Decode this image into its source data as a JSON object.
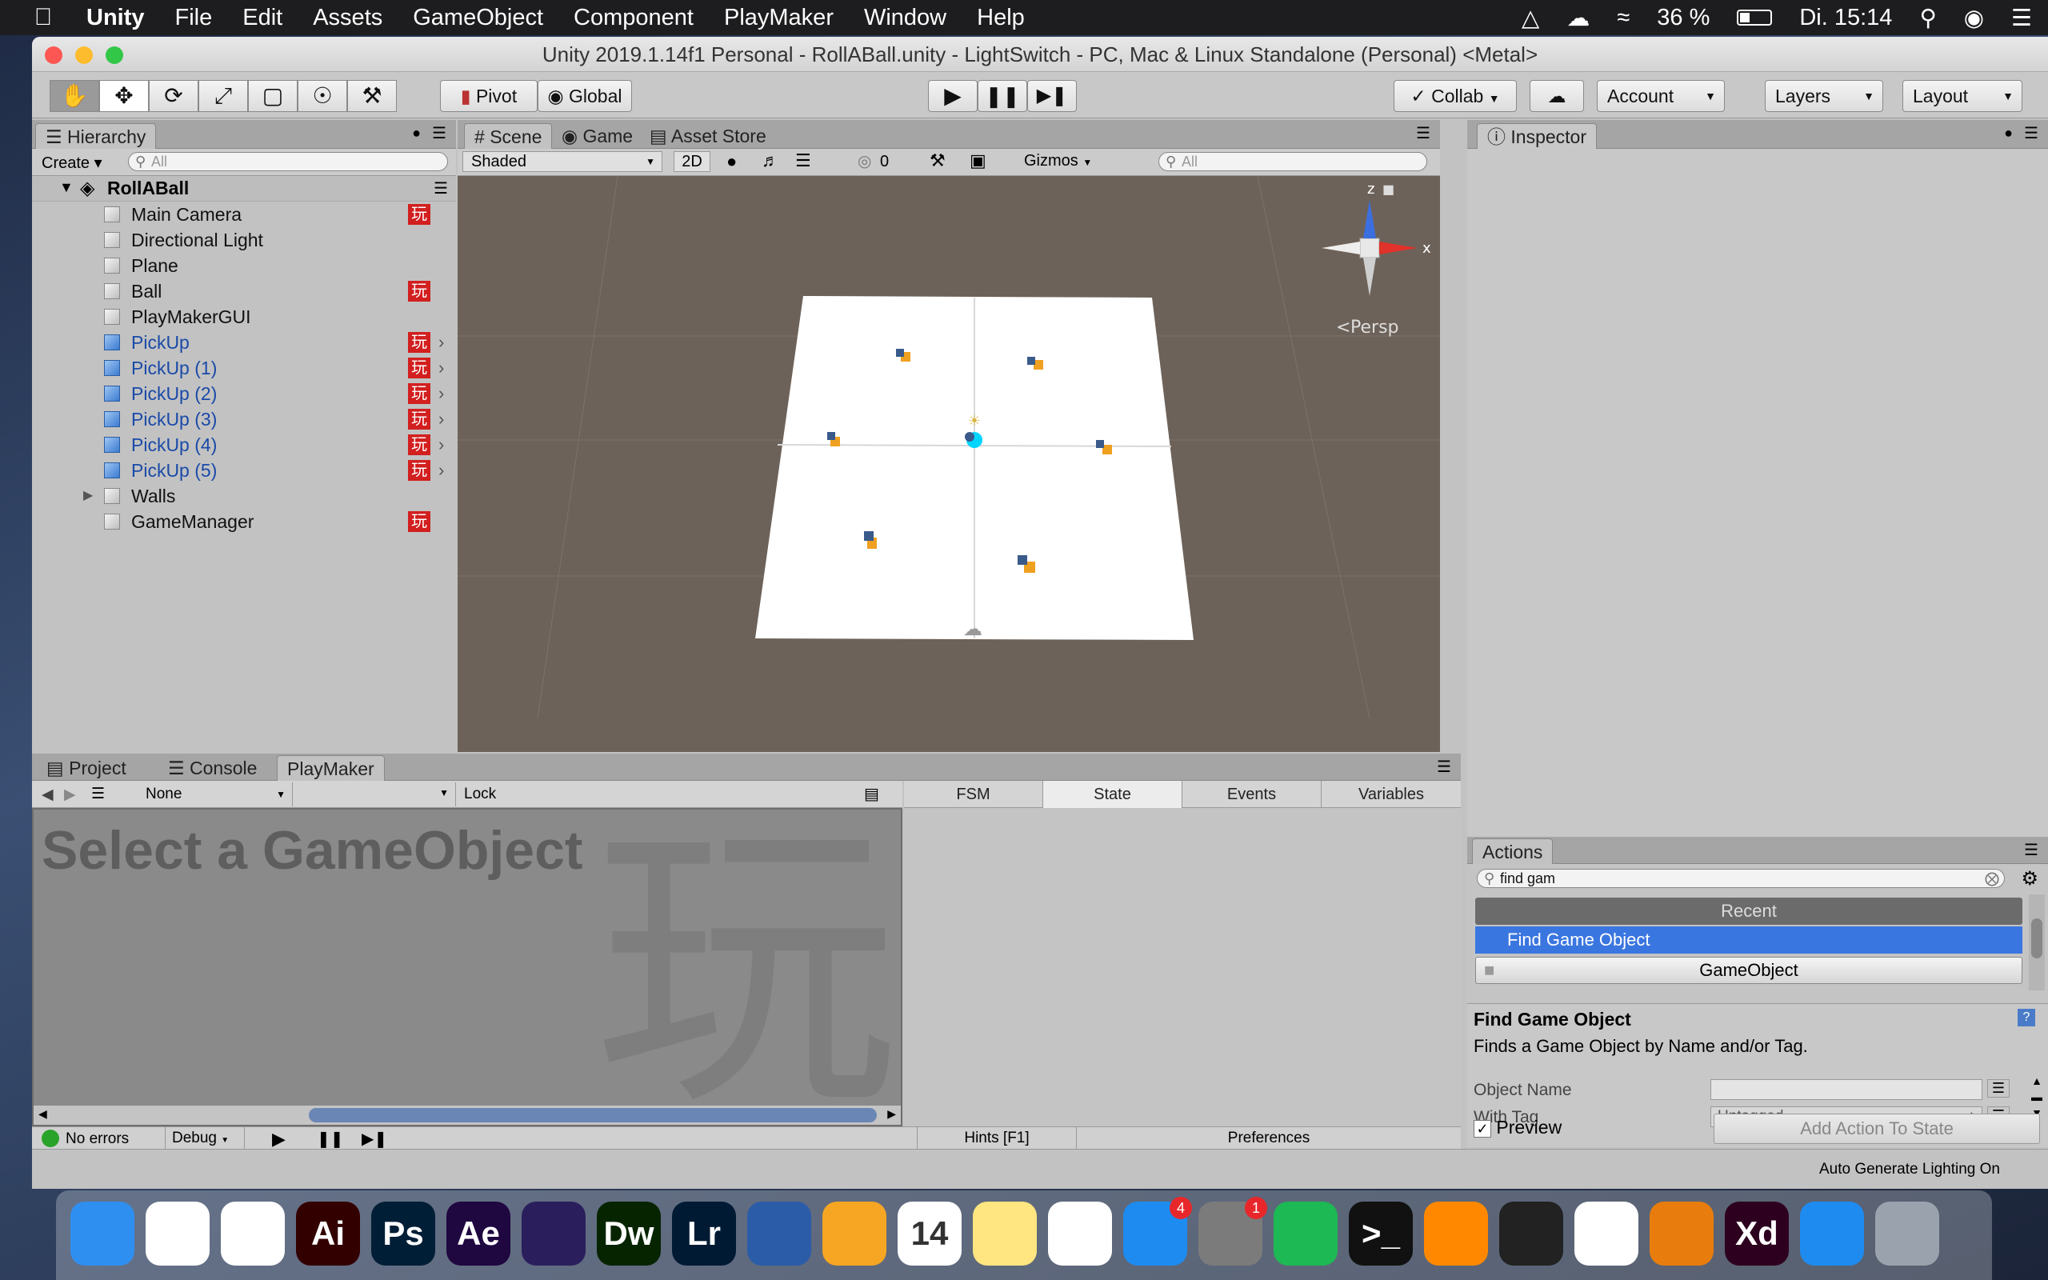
{
  "menubar": {
    "app": "Unity",
    "items": [
      "File",
      "Edit",
      "Assets",
      "GameObject",
      "Component",
      "PlayMaker",
      "Window",
      "Help"
    ],
    "battery": "36 %",
    "clock": "Di. 15:14"
  },
  "window": {
    "title": "Unity 2019.1.14f1 Personal - RollABall.unity - LightSwitch - PC, Mac & Linux Standalone (Personal) <Metal>"
  },
  "toolbar": {
    "pivot": "Pivot",
    "global": "Global",
    "collab": "Collab",
    "account": "Account",
    "layers": "Layers",
    "layout": "Layout"
  },
  "hierarchy": {
    "tab": "Hierarchy",
    "create": "Create",
    "search_placeholder": "All",
    "scene": "RollABall",
    "items": [
      {
        "name": "Main Camera",
        "fsm": true
      },
      {
        "name": "Directional Light"
      },
      {
        "name": "Plane"
      },
      {
        "name": "Ball",
        "fsm": true
      },
      {
        "name": "PlayMakerGUI"
      },
      {
        "name": "PickUp",
        "fsm": true,
        "prefab": true
      },
      {
        "name": "PickUp (1)",
        "fsm": true,
        "prefab": true
      },
      {
        "name": "PickUp (2)",
        "fsm": true,
        "prefab": true
      },
      {
        "name": "PickUp (3)",
        "fsm": true,
        "prefab": true
      },
      {
        "name": "PickUp (4)",
        "fsm": true,
        "prefab": true
      },
      {
        "name": "PickUp (5)",
        "fsm": true,
        "prefab": true
      },
      {
        "name": "Walls",
        "expandable": true
      },
      {
        "name": "GameManager",
        "fsm": true
      }
    ]
  },
  "scene": {
    "tabs": [
      "Scene",
      "Game",
      "Asset Store"
    ],
    "shading": "Shaded",
    "mode_2d": "2D",
    "hidden_count": "0",
    "gizmos": "Gizmos",
    "search_placeholder": "All",
    "persp": "Persp",
    "axis_y": "z",
    "axis_x": "x"
  },
  "inspector": {
    "tab": "Inspector"
  },
  "bottom": {
    "tabs": [
      "Project",
      "Console",
      "PlayMaker"
    ],
    "fsm_select": "None",
    "lock": "Lock",
    "pm_tabs": [
      "FSM",
      "State",
      "Events",
      "Variables"
    ],
    "placeholder": "Select a GameObject",
    "status_errors": "No errors",
    "debug": "Debug",
    "hints": "Hints [F1]",
    "preferences": "Preferences"
  },
  "actions": {
    "tab": "Actions",
    "search_value": "find gam",
    "recent": "Recent",
    "selected": "Find Game Object",
    "category": "GameObject",
    "title": "Find Game Object",
    "description": "Finds a Game Object by Name and/or Tag.",
    "field_object_name": "Object Name",
    "field_with_tag": "With Tag",
    "tag_value": "Untagged",
    "preview": "Preview",
    "add_button": "Add Action To State"
  },
  "statusbar": {
    "lighting": "Auto Generate Lighting On"
  },
  "dock": {
    "apps": [
      {
        "name": "Finder",
        "icon": "finder-icon",
        "label": "",
        "color": "#2f8ff0"
      },
      {
        "name": "Chrome",
        "icon": "chrome-icon",
        "label": "",
        "color": "#ffffff"
      },
      {
        "name": "Graph",
        "icon": "graph-icon",
        "label": "",
        "color": "#ffffff"
      },
      {
        "name": "Illustrator",
        "icon": "illustrator-icon",
        "label": "Ai",
        "color": "#330000"
      },
      {
        "name": "Photoshop",
        "icon": "photoshop-icon",
        "label": "Ps",
        "color": "#001e36"
      },
      {
        "name": "After Effects",
        "icon": "aftereffects-icon",
        "label": "Ae",
        "color": "#1f0740"
      },
      {
        "name": "Premiere",
        "icon": "premiere-icon",
        "label": "",
        "color": "#2a1f5c"
      },
      {
        "name": "Dreamweaver",
        "icon": "dreamweaver-icon",
        "label": "Dw",
        "color": "#072401"
      },
      {
        "name": "Lightroom",
        "icon": "lightroom-icon",
        "label": "Lr",
        "color": "#001a33"
      },
      {
        "name": "Frame",
        "icon": "frame-icon",
        "label": "",
        "color": "#2b5ca8"
      },
      {
        "name": "Pages",
        "icon": "pages-icon",
        "label": "",
        "color": "#f6a623"
      },
      {
        "name": "Calendar",
        "icon": "calendar-icon",
        "label": "14",
        "color": "#ffffff"
      },
      {
        "name": "Notes",
        "icon": "notes-icon",
        "label": "",
        "color": "#ffe680"
      },
      {
        "name": "Photos",
        "icon": "photos-icon",
        "label": "",
        "color": "#ffffff"
      },
      {
        "name": "App Store",
        "icon": "appstore-icon",
        "label": "",
        "color": "#1e8bf0",
        "badge": "4"
      },
      {
        "name": "System Preferences",
        "icon": "settings-icon",
        "label": "",
        "color": "#7b7b7b",
        "badge": "1"
      },
      {
        "name": "Spotify",
        "icon": "spotify-icon",
        "label": "",
        "color": "#1db954"
      },
      {
        "name": "Terminal",
        "icon": "terminal-icon",
        "label": ">_",
        "color": "#111111"
      },
      {
        "name": "VLC",
        "icon": "vlc-icon",
        "label": "",
        "color": "#ff8800"
      },
      {
        "name": "Unity Hub",
        "icon": "unityhub-icon",
        "label": "",
        "color": "#222222"
      },
      {
        "name": "Unity",
        "icon": "unity-icon",
        "label": "",
        "color": "#ffffff"
      },
      {
        "name": "Blender",
        "icon": "blender-icon",
        "label": "",
        "color": "#e87d0d"
      },
      {
        "name": "Adobe XD",
        "icon": "xd-icon",
        "label": "Xd",
        "color": "#2e001f"
      },
      {
        "name": "Safari",
        "icon": "safari-icon",
        "label": "",
        "color": "#1e8bf0"
      },
      {
        "name": "Trash",
        "icon": "trash-icon",
        "label": "",
        "color": "#9aa2ad"
      }
    ]
  }
}
